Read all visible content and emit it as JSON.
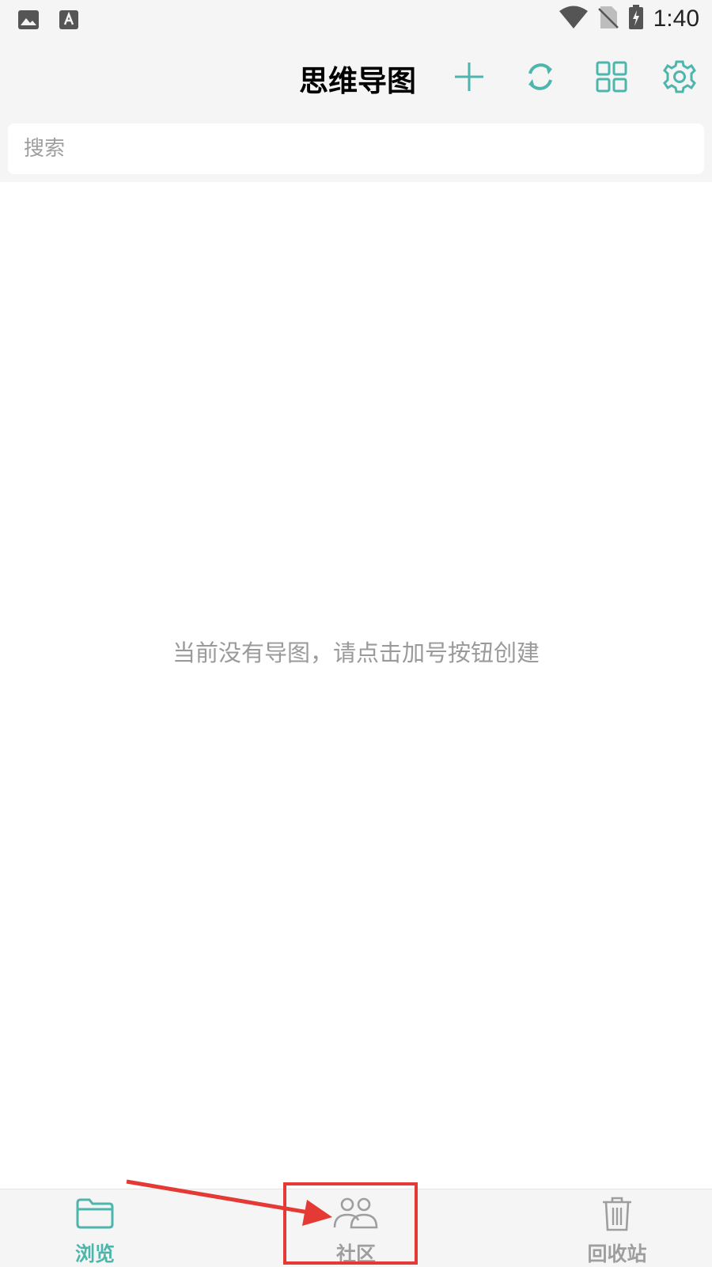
{
  "status_bar": {
    "time": "1:40",
    "icons": [
      "image-icon",
      "text-a-icon",
      "wifi-icon",
      "no-sim-icon",
      "battery-charging-icon"
    ]
  },
  "app_bar": {
    "title": "思维导图",
    "actions": [
      "add-icon",
      "sync-icon",
      "grid-view-icon",
      "settings-icon"
    ]
  },
  "search": {
    "placeholder": "搜索",
    "value": ""
  },
  "content": {
    "empty_message": "当前没有导图，请点击加号按钮创建"
  },
  "bottom_nav": {
    "items": [
      {
        "label": "浏览",
        "icon": "folder-icon",
        "active": true
      },
      {
        "label": "社区",
        "icon": "community-icon",
        "active": false
      },
      {
        "label": "回收站",
        "icon": "trash-icon",
        "active": false
      }
    ]
  },
  "colors": {
    "accent": "#4db6ac",
    "inactive": "#9e9e9e",
    "annotation": "#e53935"
  }
}
